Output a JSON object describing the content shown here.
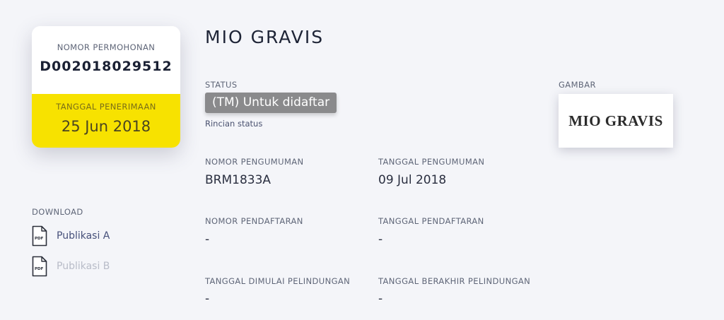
{
  "application": {
    "number_caption": "NOMOR PERMOHONAN",
    "number": "D002018029512",
    "received_caption": "TANGGAL PENERIMAAN",
    "received_date": "25 Jun 2018",
    "card_accent_color": "#f7e200"
  },
  "download": {
    "title": "DOWNLOAD",
    "items": [
      {
        "label": "Publikasi A",
        "icon": "pdf-file-icon",
        "enabled": true
      },
      {
        "label": "Publikasi B",
        "icon": "pdf-file-icon",
        "enabled": false
      }
    ]
  },
  "mark": {
    "title": "MIO GRAVIS"
  },
  "status": {
    "caption": "STATUS",
    "value": "(TM) Untuk didaftar",
    "details_link": "Rincian status",
    "badge_color": "#8a8a8c"
  },
  "image": {
    "caption": "GAMBAR",
    "logo_text": "MIO GRAVIS"
  },
  "fields": {
    "announcement_number": {
      "caption": "NOMOR PENGUMUMAN",
      "value": "BRM1833A"
    },
    "announcement_date": {
      "caption": "TANGGAL PENGUMUMAN",
      "value": "09 Jul 2018"
    },
    "registration_number": {
      "caption": "NOMOR PENDAFTARAN",
      "value": "-"
    },
    "registration_date": {
      "caption": "TANGGAL PENDAFTARAN",
      "value": "-"
    },
    "protection_start": {
      "caption": "TANGGAL DIMULAI PELINDUNGAN",
      "value": "-"
    },
    "protection_end": {
      "caption": "TANGGAL BERAKHIR PELINDUNGAN",
      "value": "-"
    }
  }
}
